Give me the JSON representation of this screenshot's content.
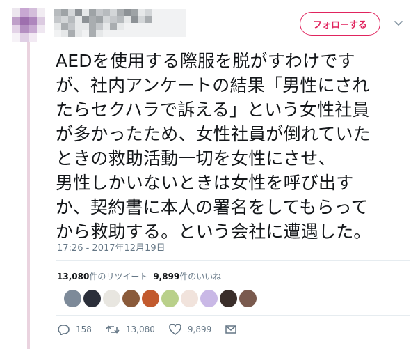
{
  "header": {
    "follow_label": "フォローする",
    "avatar_icon": "avatar-blurred",
    "username": "",
    "handle": ""
  },
  "tweet": {
    "lines": [
      "AEDを使用する際服を脱がすわけです",
      "が、社内アンケートの結果「男性にされ",
      "たらセクハラで訴える」という女性社員",
      "が多かったため、女性社員が倒れていた",
      "ときの救助活動一切を女性にさせ、",
      "男性しかいないときは女性を呼び出す",
      "か、契約書に本人の署名をしてもらって",
      "から救助する。という会社に遭遇した。"
    ],
    "timestamp": "17:26 - 2017年12月19日"
  },
  "stats": {
    "retweets_count": "13,080",
    "retweets_label": "件のリツイート",
    "likes_count": "9,899",
    "likes_label": "件のいいね"
  },
  "likers": [
    {
      "icon": "liker-avatar",
      "color": "#7d8a99"
    },
    {
      "icon": "liker-avatar",
      "color": "#2b2f3a"
    },
    {
      "icon": "liker-avatar",
      "color": "#e8e6e0"
    },
    {
      "icon": "liker-avatar",
      "color": "#8a5a3a"
    },
    {
      "icon": "liker-avatar",
      "color": "#c25a2e"
    },
    {
      "icon": "liker-avatar",
      "color": "#b9d08a"
    },
    {
      "icon": "liker-avatar",
      "color": "#f1e3dc"
    },
    {
      "icon": "liker-avatar",
      "color": "#c9b8e6"
    },
    {
      "icon": "liker-avatar",
      "color": "#3a2e2a"
    },
    {
      "icon": "liker-avatar",
      "color": "#7a5a4e"
    }
  ],
  "actions": {
    "reply_count": "158",
    "retweet_count": "13,080",
    "like_count": "9,899",
    "reply_icon": "reply-icon",
    "retweet_icon": "retweet-icon",
    "like_icon": "heart-icon",
    "dm_icon": "envelope-icon"
  },
  "colors": {
    "accent": "#e0245e",
    "secondary_text": "#657786",
    "thread_line": "#ead3df"
  }
}
